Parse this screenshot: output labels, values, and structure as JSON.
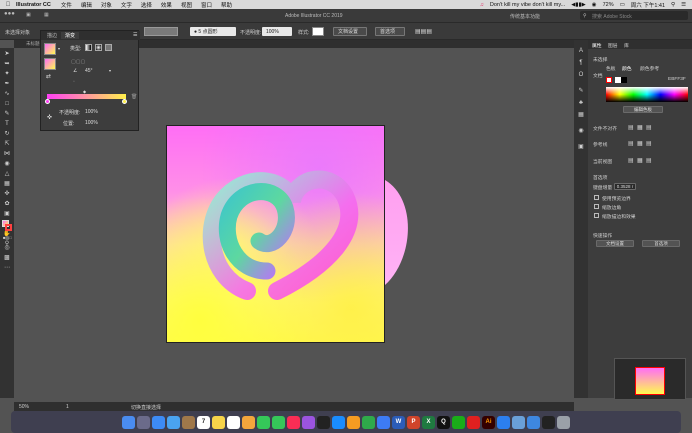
{
  "menubar": {
    "app_name": "Illustrator CC",
    "items": [
      "文件",
      "编辑",
      "对象",
      "文字",
      "选择",
      "效果",
      "视图",
      "窗口",
      "帮助"
    ],
    "now_playing": "Don't kill my vibe don't kill my...",
    "battery": "72%",
    "datetime": "周六 下午1:41"
  },
  "titlebar": {
    "title": "Adobe Illustrator CC 2019",
    "workspace": "传统基本功能",
    "search_placeholder": "搜索 Adobe Stock"
  },
  "control": {
    "selection_label": "未选择对象",
    "stroke_profile": "5 点圆形",
    "opacity_label": "不透明度:",
    "opacity_value": "100%",
    "style_label": "样式:",
    "doc_setup": "文档设置",
    "preferences": "首选项"
  },
  "doc_tab": {
    "label": "未标题-1* @ 25% (RGB/GPU 预览)"
  },
  "gradient_panel": {
    "tabs": [
      "描边",
      "渐变"
    ],
    "type_label": "类型:",
    "angle_value": "45°",
    "opacity_label": "不透明度:",
    "opacity_value": "100%",
    "position_label": "位置:",
    "position_value": "100%"
  },
  "right_panel": {
    "tabs": [
      "属性",
      "图层",
      "库"
    ],
    "no_selection": "未选择",
    "color_tabs": [
      "色板",
      "颜色",
      "颜色参考"
    ],
    "doc_label": "文档",
    "hex_value": "EBFF3F",
    "swatch_button": "编辑色板",
    "align_label": "文件不对齐",
    "ref_label": "参考线",
    "preview_label": "当前视图",
    "unit_label": "首选项",
    "keyboard_inc_label": "键盘增量",
    "keyboard_inc_value": "0.3528 r",
    "checks": [
      "使用预览边界",
      "缩放边角",
      "缩放描边和效果"
    ],
    "quick_actions_label": "快速操作",
    "doc_setup_btn": "文档设置",
    "prefs_btn": "首选项"
  },
  "statusbar": {
    "zoom": "50%",
    "page": "1",
    "tool_label": "切换直接选择"
  },
  "dock": {
    "icons": [
      "finder-icon",
      "launchpad-icon",
      "safari-icon",
      "mail-icon",
      "contacts-icon",
      "calendar-icon",
      "notes-icon",
      "reminders-icon",
      "photos-icon",
      "messages-icon",
      "facetime-icon",
      "music-icon",
      "podcasts-icon",
      "tv-icon",
      "appstore-icon",
      "pages-icon",
      "numbers-icon",
      "keynote-icon",
      "word-icon",
      "powerpoint-icon",
      "excel-icon",
      "qq-icon",
      "wechat-icon",
      "netease-music-icon",
      "illustrator-icon",
      "wechat-work-icon",
      "preview-icon",
      "finder2-icon",
      "terminal-icon",
      "trash-icon"
    ],
    "colors": [
      "#4a8cf0",
      "#6b6b8a",
      "#3d8bf5",
      "#4aa3f0",
      "#a0784a",
      "#ffffff",
      "#f7d44a",
      "#ffffff",
      "#f4a63c",
      "#35c759",
      "#35c759",
      "#fa2d55",
      "#9b54e0",
      "#222",
      "#1a8cff",
      "#f59b22",
      "#2faa4a",
      "#3d7bf5",
      "#2b5cb8",
      "#d0442b",
      "#1f7a40",
      "#111",
      "#1aad19",
      "#e02020",
      "#330000",
      "#2c7ff0",
      "#6aa0d8",
      "#3e87e0",
      "#222",
      "#9aa0a8"
    ],
    "labels": {
      "word-icon": "W",
      "powerpoint-icon": "P",
      "excel-icon": "X",
      "illustrator-icon": "Ai",
      "calendar-icon": "7",
      "qq-icon": "Q"
    }
  }
}
